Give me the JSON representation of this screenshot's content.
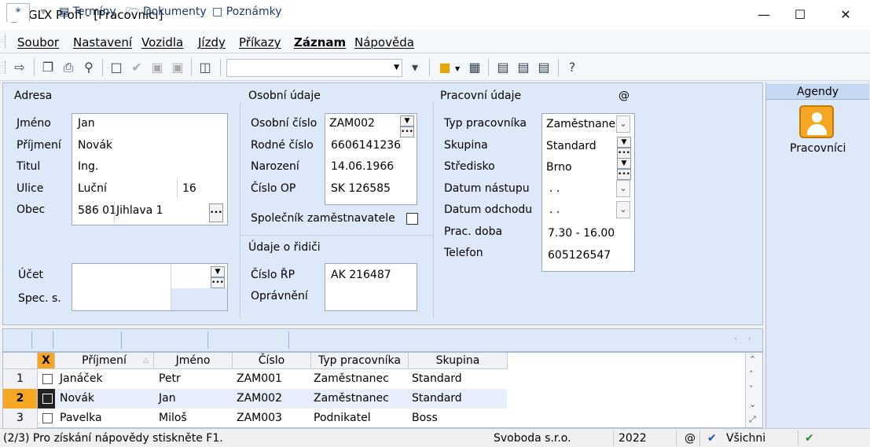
{
  "window": {
    "title": "GLX Profi - [Pracovníci]"
  },
  "menu": [
    "Soubor",
    "Nastavení",
    "Vozidla",
    "Jízdy",
    "Příkazy",
    "Záznam",
    "Nápověda"
  ],
  "toolbar": {
    "combo_value": ""
  },
  "sections": {
    "adresa": "Adresa",
    "osobni": "Osobní údaje",
    "pracovni": "Pracovní údaje",
    "ridic": "Údaje o řidiči",
    "at": "@"
  },
  "adresa": {
    "jmeno_label": "Jméno",
    "jmeno": "Jan",
    "prijmeni_label": "Příjmení",
    "prijmeni": "Novák",
    "titul_label": "Titul",
    "titul": "Ing.",
    "ulice_label": "Ulice",
    "ulice": "Luční",
    "cislo": "16",
    "obec_label": "Obec",
    "psc": "586 01",
    "obec": "Jihlava 1",
    "ucet_label": "Účet",
    "ucet": "",
    "ucet_code": "",
    "spec_label": "Spec. s.",
    "spec": ""
  },
  "osobni": {
    "osobni_cislo_label": "Osobní číslo",
    "osobni_cislo": "ZAM002",
    "rodne_label": "Rodné číslo",
    "rodne": "6606141236",
    "narozeni_label": "Narození",
    "narozeni": "14.06.1966",
    "op_label": "Číslo OP",
    "op": "SK 126585",
    "spolecnik_label": "Společník zaměstnavatele"
  },
  "ridic": {
    "rp_label": "Číslo ŘP",
    "rp": "AK 216487",
    "opravneni_label": "Oprávnění",
    "opravneni": ""
  },
  "pracovni": {
    "typ_label": "Typ pracovníka",
    "typ": "Zaměstnanec",
    "skupina_label": "Skupina",
    "skupina": "Standard",
    "stredisko_label": "Středisko",
    "stredisko": "Brno",
    "nastup_label": "Datum nástupu",
    "nastup": " .  .",
    "odchod_label": "Datum odchodu",
    "odchod": " .  .",
    "doba_label": "Prac. doba",
    "doba": "7.30 - 16.00",
    "telefon_label": "Telefon",
    "telefon": "605126547"
  },
  "agendy": {
    "header": "Agendy",
    "item": "Pracovníci"
  },
  "tabs": {
    "star": "*",
    "items": [
      "Termíny",
      "Dokumenty",
      "Poznámky"
    ]
  },
  "grid": {
    "headers": [
      "X",
      "Příjmení",
      "Jméno",
      "Číslo",
      "Typ pracovníka",
      "Skupina"
    ],
    "rows": [
      {
        "n": "1",
        "prijmeni": "Janáček",
        "jmeno": "Petr",
        "cislo": "ZAM001",
        "typ": "Zaměstnanec",
        "skupina": "Standard"
      },
      {
        "n": "2",
        "prijmeni": "Novák",
        "jmeno": "Jan",
        "cislo": "ZAM002",
        "typ": "Zaměstnanec",
        "skupina": "Standard"
      },
      {
        "n": "3",
        "prijmeni": "Pavelka",
        "jmeno": "Miloš",
        "cislo": "ZAM003",
        "typ": "Podnikatel",
        "skupina": "Boss"
      }
    ]
  },
  "status": {
    "help": "(2/3) Pro získání nápovědy stiskněte F1.",
    "company": "Svoboda s.r.o.",
    "year": "2022",
    "at": "@",
    "filter": "Všichni"
  },
  "colors": {
    "accent": "#f5a623",
    "panel": "#dde8f8",
    "selected_row": "#f5a623"
  }
}
